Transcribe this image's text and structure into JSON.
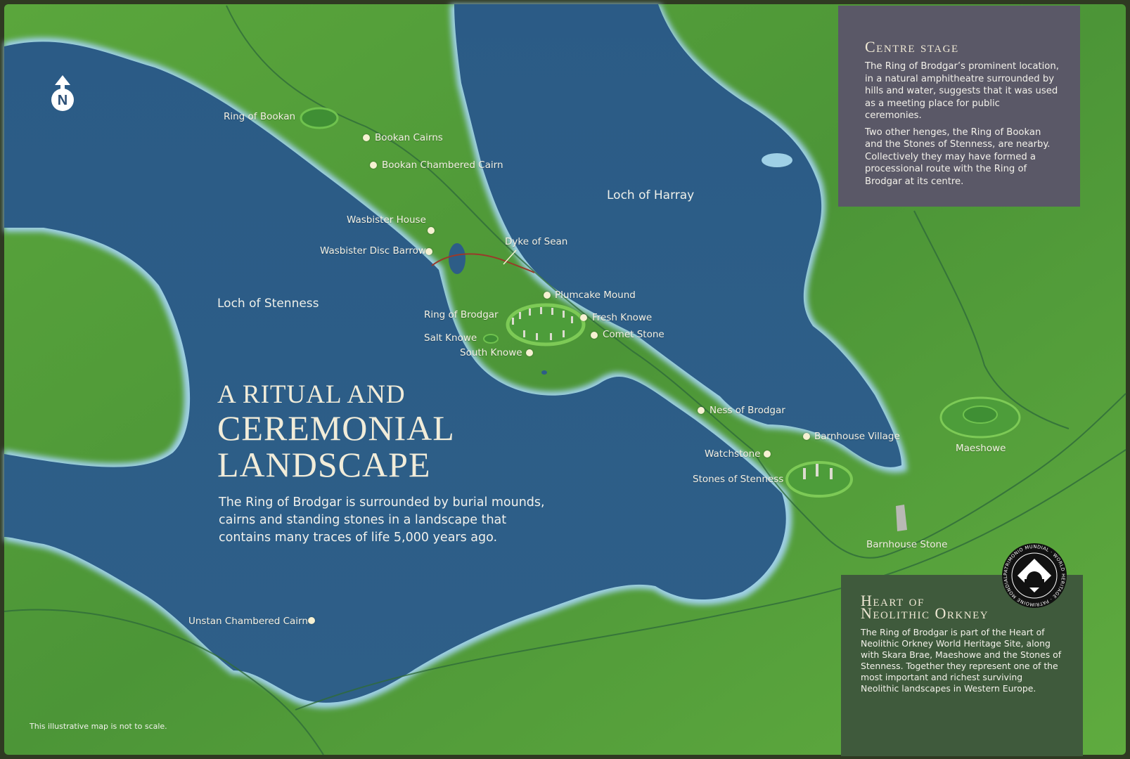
{
  "board": {
    "title_line1": "A ritual and",
    "title_line2": "CEREMONIAL",
    "title_line3": "LANDSCAPE",
    "intro": "The Ring of Brodgar is surrounded by burial mounds, cairns and standing stones in a landscape that contains many traces of life 5,000 years ago.",
    "scale_note": "This illustrative map is not to scale.",
    "compass_letter": "N"
  },
  "centre_stage": {
    "title": "Centre stage",
    "paragraph1": "The Ring of Brodgar’s prominent location, in a natural amphitheatre surrounded by hills and water, suggests that it was used as a meeting place for public ceremonies.",
    "paragraph2": "Two other henges, the Ring of Bookan and the Stones of Stenness, are nearby. Collectively they may have formed a processional route with the Ring of Brodgar at its centre."
  },
  "heart_of_orkney": {
    "title_line1": "Heart of",
    "title_line2": "Neolithic Orkney",
    "paragraph": "The Ring of Brodgar is part of the Heart of Neolithic Orkney World Heritage Site, along with Skara Brae, Maeshowe and the Stones of Stenness. Together they represent one of the most important and richest surviving Neolithic landscapes in Western Europe.",
    "logo_ring_text": "PATRIMONIO MUNDIAL · WORLD HERITAGE · PATRIMOINE MONDIAL"
  },
  "water": {
    "loch_harray": "Loch of Harray",
    "loch_stenness": "Loch of Stenness"
  },
  "sites": {
    "ring_of_bookan": "Ring of Bookan",
    "bookan_cairns": "Bookan Cairns",
    "bookan_chambered_cairn": "Bookan Chambered Cairn",
    "wasbister_house": "Wasbister House",
    "wasbister_disc_barrow": "Wasbister Disc Barrow",
    "dyke_of_sean": "Dyke of Sean",
    "plumcake_mound": "Plumcake Mound",
    "ring_of_brodgar": "Ring of Brodgar",
    "fresh_knowe": "Fresh Knowe",
    "salt_knowe": "Salt Knowe",
    "comet_stone": "Comet Stone",
    "south_knowe": "South Knowe",
    "ness_of_brodgar": "Ness of Brodgar",
    "barnhouse_village": "Barnhouse Village",
    "watchstone": "Watchstone",
    "stones_of_stenness": "Stones of Stenness",
    "maeshowe": "Maeshowe",
    "barnhouse_stone": "Barnhouse Stone",
    "unstan_chambered_cairn": "Unstan Chambered Cairn"
  },
  "colors": {
    "land": "#4f9a3a",
    "water": "#2f5f88",
    "centre_panel": "#5a5867",
    "heart_panel": "#3f5a3c"
  }
}
